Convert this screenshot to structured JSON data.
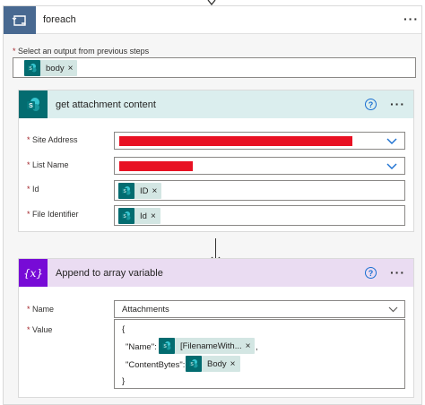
{
  "foreach": {
    "title": "foreach",
    "menu": "···",
    "select_label_required": "*",
    "select_label": " Select an output from previous steps",
    "token": {
      "label": "body",
      "remove": "×"
    }
  },
  "get_attachment": {
    "title": "get attachment content",
    "help": "?",
    "menu": "···",
    "header_color": "#dbeeee",
    "fields": [
      {
        "required": "*",
        "label": " Site Address"
      },
      {
        "required": "*",
        "label": " List Name"
      },
      {
        "required": "*",
        "label": " Id",
        "token": "ID",
        "remove": "×"
      },
      {
        "required": "*",
        "label": " File Identifier",
        "token": "Id",
        "remove": "×"
      }
    ]
  },
  "append": {
    "title": "Append to array variable",
    "help": "?",
    "menu": "···",
    "header_color": "#eadcf2",
    "icon_text": "{x}",
    "name_required": "*",
    "name_label": " Name",
    "name_value": "Attachments",
    "value_required": "*",
    "value_label": " Value",
    "value_lines": {
      "open": "{",
      "name_key": "\"Name\":",
      "name_token": "[FilenameWith...",
      "name_remove": "×",
      "comma": ",",
      "content_key": "\"ContentBytes\":",
      "content_token": "Body",
      "content_remove": "×",
      "close": "}"
    }
  },
  "colors": {
    "loop": "#486991",
    "sharepoint": "#036c70",
    "variable": "#770bd6",
    "token_bg": "#d3e6e3",
    "redaction": "#e81123"
  }
}
